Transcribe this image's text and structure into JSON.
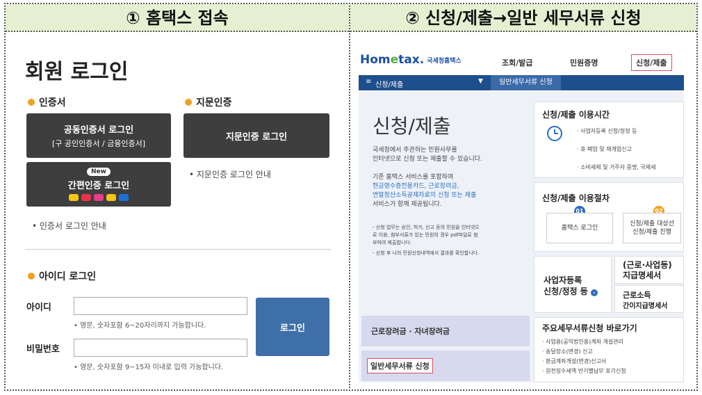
{
  "headers": {
    "left": "① 홈택스 접속",
    "right": "② 신청/제출→일반 세무서류 신청"
  },
  "login": {
    "title": "회원 로그인",
    "cert_section": "인증서",
    "fingerprint_section": "지문인증",
    "joint_cert_btn": "공동인증서 로그인",
    "joint_cert_sub": "[구 공인인증서 / 금융인증서]",
    "fingerprint_btn": "지문인증 로그인",
    "new_badge": "New",
    "simple_cert_btn": "간편인증 로그인",
    "fingerprint_note": "• 지문인증 로그인 안내",
    "cert_note": "• 인증서 로그인 안내",
    "id_section": "아이디 로그인",
    "id_label": "아이디",
    "id_hint": "• 영문, 숫자포함 6~20자리까지 가능합니다.",
    "pw_label": "비밀번호",
    "pw_hint": "• 영문, 숫자포함 9~15자 이내로 입력 가능합니다.",
    "login_btn": "로그인"
  },
  "hometax": {
    "logo_main": "Hom",
    "logo_e": "e",
    "logo_tail": "tax.",
    "logo_ko": "국세청홈택스",
    "menu": [
      "조회/발급",
      "민원증명",
      "신청/제출"
    ],
    "nav_current": "신청/제출",
    "nav_crumb": "일반세무서류 신청",
    "page_title": "신청/제출",
    "desc1": "국세청에서 주관하는 민원사무를",
    "desc2": "인터넷으로 신청 또는 제출할 수 있습니다.",
    "desc3": "기존 홈택스 서비스를 포함하여",
    "desc4": "현금영수증전용카드, 근로장려금,",
    "desc5": "연말정산소득공제자료의 신청 또는 제출",
    "desc6": "서비스가 함께 제공됩니다.",
    "bullet1a": "- 신청 업무는 승인, 허가, 신고 등의 민원을 인터넷으",
    "bullet1b": "로 이용, 첨부서류가 있는 민원의 경우 pdf파일로 첨",
    "bullet1c": "부하여 제출합니다.",
    "bullet2": "- 신청 후 나의 민원신청내역에서 결과를 확인합니다.",
    "hours_title": "신청/제출 이용시간",
    "hours_items": [
      "· 사업자등록 신청/정정 등",
      "· 휴·폐업 및 재개업신고",
      "· 소비세제 및 거주자 증명, 국제세"
    ],
    "proc_title": "신청/제출 이용절차",
    "step1_num": "01",
    "step1_label": "홈택스 로그인",
    "step2_num": "02",
    "step2_label1": "신청/제출 대상선",
    "step2_label2": "신청/제출 진행",
    "biz_reg1": "사업자등록",
    "biz_reg2": "신청/정정 등",
    "work_pay1": "(근로·사업등)",
    "work_pay2": "지급명세서",
    "simple_pay1": "근로소득",
    "simple_pay2": "간이지급명세서",
    "eitc_btn": "근로장려금 · 자녀장려금",
    "general_btn": "일반세무서류 신청",
    "quick_title": "주요세무서류신청 바로가기",
    "quick_items": [
      "· 사업용(공익법인용)계좌 개설관리",
      "· 송달장소(변경) 신고",
      "· 환급계좌개설(변경)신고서",
      "· 원천징수세액 반기별납부 포기신청"
    ]
  },
  "colors": {
    "header_band": "#e6efd2",
    "dark_button": "#3e3e3e",
    "login_button": "#3f6fa8",
    "navbar": "#1e4f8d",
    "highlight": "#e04a5a",
    "lavender": "#d7d9ef",
    "step1": "#2a6dc0",
    "step2": "#f0a020"
  }
}
